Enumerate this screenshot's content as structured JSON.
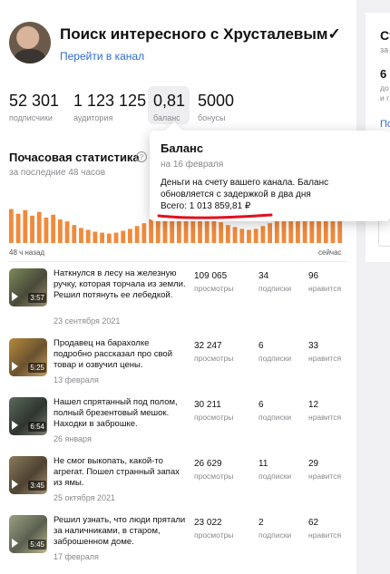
{
  "channel": {
    "title": "Поиск интересного с Хрусталевым✓",
    "link": "Перейти в канал"
  },
  "stats": [
    {
      "value": "52 301",
      "label": "подписчики"
    },
    {
      "value": "1 123 125",
      "label": "аудитория"
    },
    {
      "value": "0,81",
      "label": "баланс"
    },
    {
      "value": "5000",
      "label": "бонусы"
    }
  ],
  "hourly": {
    "title": "Почасовая статистика",
    "help": "?",
    "subtitle": "за последние 48 часов",
    "axis_left": "48 ч назад",
    "axis_right": "сейчас",
    "bar_color": "#f08a3c"
  },
  "chart_data": {
    "type": "bar",
    "values": [
      0.72,
      0.62,
      0.7,
      0.58,
      0.66,
      0.54,
      0.6,
      0.5,
      0.46,
      0.38,
      0.32,
      0.28,
      0.24,
      0.22,
      0.2,
      0.22,
      0.26,
      0.3,
      0.36,
      0.42,
      0.5,
      0.56,
      0.62,
      0.66,
      0.7,
      0.68,
      0.64,
      0.6,
      0.56,
      0.5,
      0.44,
      0.38,
      0.34,
      0.3,
      0.28,
      0.3,
      0.36,
      0.42,
      0.5,
      0.56,
      0.62,
      0.66,
      0.72,
      0.76,
      0.7,
      0.74,
      0.66,
      0.7
    ]
  },
  "popup": {
    "title": "Баланс",
    "date": "на 16 февраля",
    "text": "Деньги на счету вашего канала. Баланс обновляется с задержкой в два дня",
    "total": "Всего: 1 013 859,81 ₽",
    "underline_color": "#e01020"
  },
  "metric_labels": {
    "views": "просмотры",
    "subs": "подписки",
    "likes": "нравится"
  },
  "videos": [
    {
      "title": "Наткнулся в лесу на железную ручку, которая торчала из земли. Решил потянуть ее лебедкой.",
      "date": "23 сентября 2021",
      "duration": "3:57",
      "views": "109 065",
      "subs": "34",
      "likes": "96"
    },
    {
      "title": "Продавец на барахолке подробно рассказал про свой товар и озвучил цены.",
      "date": "13 февраля",
      "duration": "5:25",
      "views": "32 247",
      "subs": "6",
      "likes": "33"
    },
    {
      "title": "Нашел спрятанный под полом, полный брезентовый мешок. Находки в заброшке.",
      "date": "26 января",
      "duration": "6:54",
      "views": "30 211",
      "subs": "6",
      "likes": "12"
    },
    {
      "title": "Не смог выкопать, какой-то агрегат. Пошел странный запах из ямы.",
      "date": "25 октября 2021",
      "duration": "3:45",
      "views": "26 629",
      "subs": "11",
      "likes": "29"
    },
    {
      "title": "Решил узнать, что люди прятали за наличниками, в старом, заброшенном доме.",
      "date": "17 февраля",
      "duration": "5:45",
      "views": "23 022",
      "subs": "2",
      "likes": "62"
    }
  ],
  "right_card": {
    "title": "Ст",
    "sub": "за",
    "num": "6",
    "line1": "до",
    "line2": "и г",
    "link": "По"
  }
}
